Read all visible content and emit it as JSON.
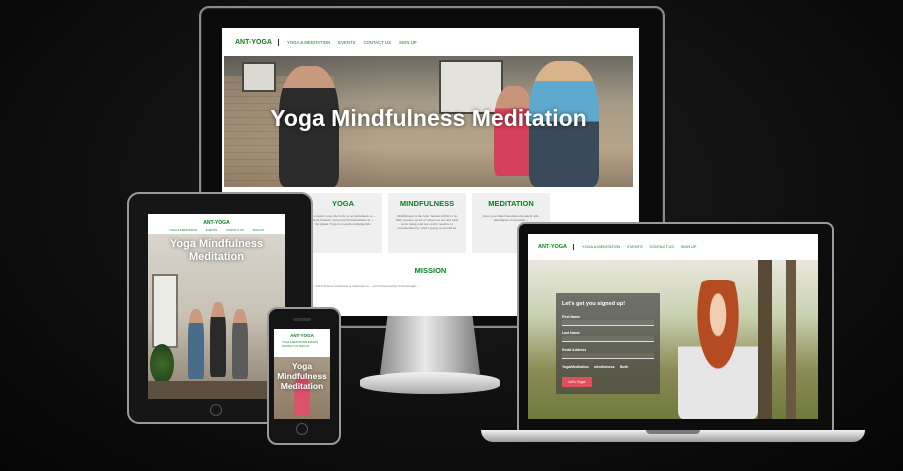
{
  "site": {
    "logo": "ANT-YOGA",
    "nav": [
      "YOGA & MEDITATION",
      "EVENTS",
      "CONTACT US",
      "SIGN UP"
    ],
    "hero_title": "Yoga Mindfulness Meditation",
    "tablet_hero": "Yoga Mindfulness Meditation",
    "phone_hero": "Yoga Mindfulness Meditation",
    "cards": [
      {
        "title": "YOGA",
        "text": "... to learn to use the body as an instrument. A ... more fantastic and powerful instrument on ... the planet. Yoga is towards realizing this."
      },
      {
        "title": "MINDFULNESS",
        "text": "Mindfulness is the basic human ability to be fully present, aware of where we are and what we're doing, and not overly reactive or overwhelmed by what's going on around us."
      },
      {
        "title": "MEDITATION",
        "text": "Once your mind becomes absolutely still, intelligence transcends ..."
      }
    ],
    "mission_title": "MISSION",
    "mission_text": "... ANT-YOGA foundation is dedicated to ... and living healthy lives through ..."
  },
  "signup": {
    "title": "Let's get you signed up!",
    "fields": [
      "First Name",
      "Last Name",
      "Email Address"
    ],
    "options_label": "Yoga/Meditation",
    "options": [
      "mindfulness",
      "Both"
    ],
    "button": "Let's Yoga!"
  },
  "colors": {
    "brand_green": "#0a7f1f",
    "button_red": "#e0505a"
  }
}
